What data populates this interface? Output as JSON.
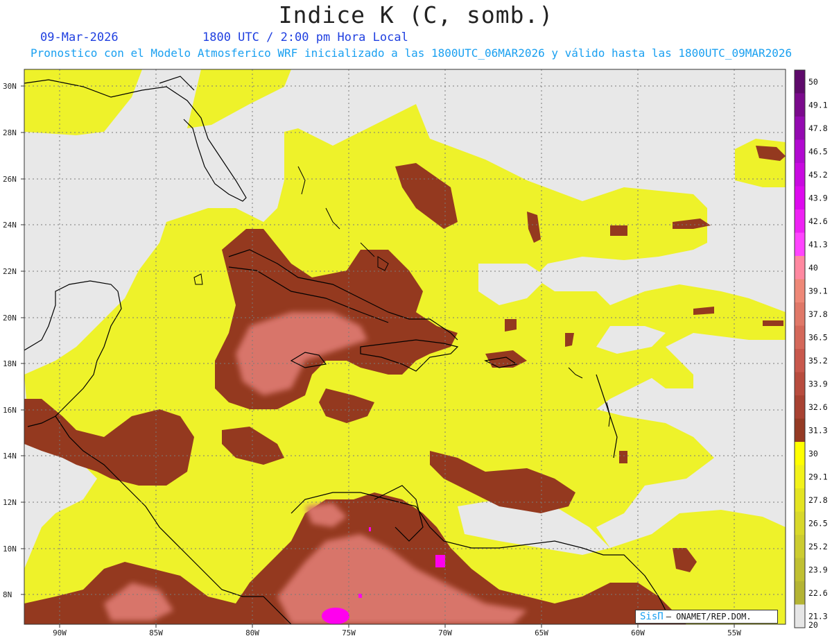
{
  "header": {
    "title": "Indice K (C, somb.)",
    "date": "09-Mar-2026",
    "time": "1800 UTC / 2:00 pm Hora Local",
    "subtitle": "Pronostico con el Modelo Atmosferico WRF inicializado a las 1800UTC_06MAR2026 y válido hasta las  1800UTC_09MAR2026"
  },
  "map": {
    "lon_range": [
      -92.5,
      -52.5
    ],
    "lat_range": [
      7.0,
      31.0
    ],
    "lat_labels": [
      "30N",
      "28N",
      "26N",
      "24N",
      "22N",
      "20N",
      "18N",
      "16N",
      "14N",
      "12N",
      "10N",
      "8N"
    ],
    "lon_labels": [
      "90W",
      "85W",
      "80W",
      "75W",
      "70W",
      "65W",
      "60W",
      "55W"
    ],
    "colors": {
      "no_data": "#e8e8e8",
      "yellow": "#eef22a",
      "yellow_edge": "#d8da3a",
      "brown": "#94391f",
      "salmon": "#d8756a",
      "magenta": "#ff00ee",
      "coast": "#000000"
    }
  },
  "colorbar": {
    "labels": [
      "50",
      "49.1",
      "47.8",
      "46.5",
      "45.2",
      "43.9",
      "42.6",
      "41.3",
      "40",
      "39.1",
      "37.8",
      "36.5",
      "35.2",
      "33.9",
      "32.6",
      "31.3",
      "30",
      "29.1",
      "27.8",
      "26.5",
      "25.2",
      "23.9",
      "22.6",
      "21.3",
      "20"
    ],
    "colors": [
      "#5e0a6b",
      "#7a0a8c",
      "#930ab0",
      "#b10ad0",
      "#c80ae0",
      "#dd0aee",
      "#ee22f4",
      "#ff44ff",
      "#ff88a0",
      "#ee8877",
      "#e07868",
      "#d4685a",
      "#c8584c",
      "#b84c3e",
      "#a84232",
      "#943a24",
      "#ffff00",
      "#f2f21a",
      "#e4e422",
      "#d8d82a",
      "#cccc30",
      "#c0c032",
      "#b4b434",
      "#e6e6e6"
    ]
  },
  "credit": {
    "brand": "SisΠ",
    "org": "– ONAMET/REP.DOM."
  }
}
